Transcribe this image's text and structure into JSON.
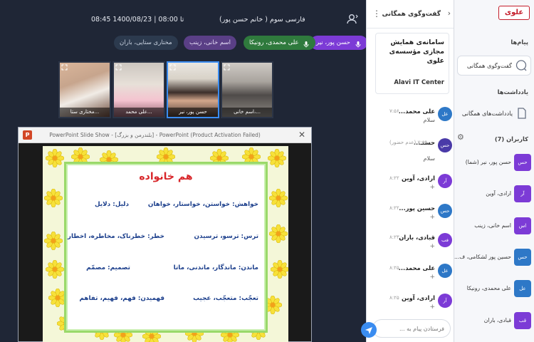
{
  "topbar": {
    "time": "08:45 تا 08:00 | 1400/08/23",
    "title": "فارسی سوم ( خانم حسن پور)"
  },
  "chips": [
    {
      "label": "حسن پور، نیر",
      "color": "#7c3bd6",
      "text": "#ffffff"
    },
    {
      "label": "علی محمدی، رونیکا",
      "color": "#2f7a3d",
      "text": "#ffffff"
    },
    {
      "label": "اسم خانی، زینب",
      "color": "#5a3f86",
      "text": "#e8e0f8"
    },
    {
      "label": "مختاری ستایی، باران",
      "color": "#2c3a4e",
      "text": "#c9d2e0"
    }
  ],
  "tiles": [
    {
      "caption": "مختاری ستا...",
      "active": false
    },
    {
      "caption": "علی محمد...",
      "active": false
    },
    {
      "caption": "حسن پور، نیر",
      "active": true
    },
    {
      "caption": "اسم خانی،...",
      "active": false
    }
  ],
  "ppt": {
    "window_title": "PowerPoint Slide Show - [بلندرمن و بزرگ] - PowerPoint (Product Activation Failed)",
    "close": "✕",
    "icon_letter": "P",
    "slide": {
      "heading": "هم خانواده",
      "rows": [
        "خواهش: خواستن، خواستار، خواهان",
        "دلیل: دلایل",
        "ترس: ترسو، ترسیدن",
        "خطر: خطرناک، مخاطره، اخطار",
        "ماندن: ماندگار، ماندنی، ماتا",
        "تصمیم: مصمّم",
        "تعجّب: متعجّب، عجیب",
        "فهمیدن: فهم، فهیم، تفاهم"
      ]
    }
  },
  "chat": {
    "header": "گفت‌وگوی همگانی",
    "back": "›",
    "more": "⋮",
    "org_name": "سامانه‌ی همایش مجازی مؤسسه‌ی علوی",
    "org_center": "Alavi IT Center",
    "messages": [
      {
        "avatar": "عل",
        "color": "#2e78c7",
        "name": "علی محمد...",
        "time": "۷:۵۶",
        "text": "سلام"
      },
      {
        "avatar": "حس",
        "color": "#4a3aa8",
        "name": "حسنـ...",
        "time": "(عدم حضور) ۷:۵۹",
        "text": "سلام"
      },
      {
        "avatar": "آر",
        "color": "#7c3bd6",
        "name": "ارادی، آوین",
        "time": "۸:۲۲",
        "text": "+"
      },
      {
        "avatar": "حس",
        "color": "#2e78c7",
        "name": "حسین پور...",
        "time": "۸:۲۲",
        "text": "+"
      },
      {
        "avatar": "فب",
        "color": "#7c3bd6",
        "name": "قبادی، باران",
        "time": "۸:۲۳",
        "text": "+"
      },
      {
        "avatar": "عل",
        "color": "#2e78c7",
        "name": "علی محمد...",
        "time": "۸:۲۵",
        "text": "+"
      },
      {
        "avatar": "آر",
        "color": "#7c3bd6",
        "name": "ارادی، آوین",
        "time": "۸:۲۵",
        "text": "+"
      }
    ],
    "composer_placeholder": "فرستادن پیام به ..."
  },
  "sidebar": {
    "logo": "علوی",
    "section_messages": "پیام‌ها",
    "public_chat": "گفت‌وگوی همگانی",
    "section_notes": "یادداشت‌ها",
    "shared_notes": "یادداشت‌های همگانی",
    "section_users": "کاربران (7)",
    "users": [
      {
        "avatar": "حس",
        "color": "#7c3bd6",
        "name": "حسن پور، نیر (شما)"
      },
      {
        "avatar": "آر",
        "color": "#7c3bd6",
        "name": "ارادی، آوین"
      },
      {
        "avatar": "اس",
        "color": "#7c3bd6",
        "name": "اسم خانی، زینب"
      },
      {
        "avatar": "حس",
        "color": "#2e78c7",
        "name": "حسین پور لشکامی، ف..."
      },
      {
        "avatar": "عل",
        "color": "#2e78c7",
        "name": "علی محمدی، رونیکا"
      },
      {
        "avatar": "قب",
        "color": "#7c3bd6",
        "name": "قبادی، باران"
      }
    ]
  }
}
